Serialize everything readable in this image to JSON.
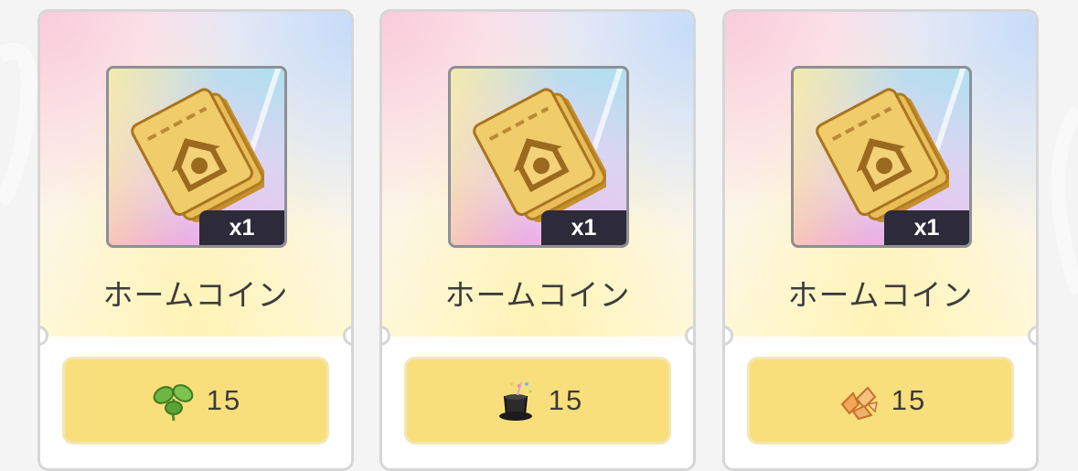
{
  "items": [
    {
      "name": "ホームコイン",
      "quantity": "x1",
      "cost": "15",
      "currency_icon": "green-leaf-sprout-icon"
    },
    {
      "name": "ホームコイン",
      "quantity": "x1",
      "cost": "15",
      "currency_icon": "magic-top-hat-icon"
    },
    {
      "name": "ホームコイン",
      "quantity": "x1",
      "cost": "15",
      "currency_icon": "orange-crystal-shards-icon"
    }
  ],
  "colors": {
    "button_fill": "#f9df7b",
    "badge_fill": "#2d2b3a",
    "card_border": "#d6d6d6",
    "ticket_gold": "#e2b24a"
  }
}
